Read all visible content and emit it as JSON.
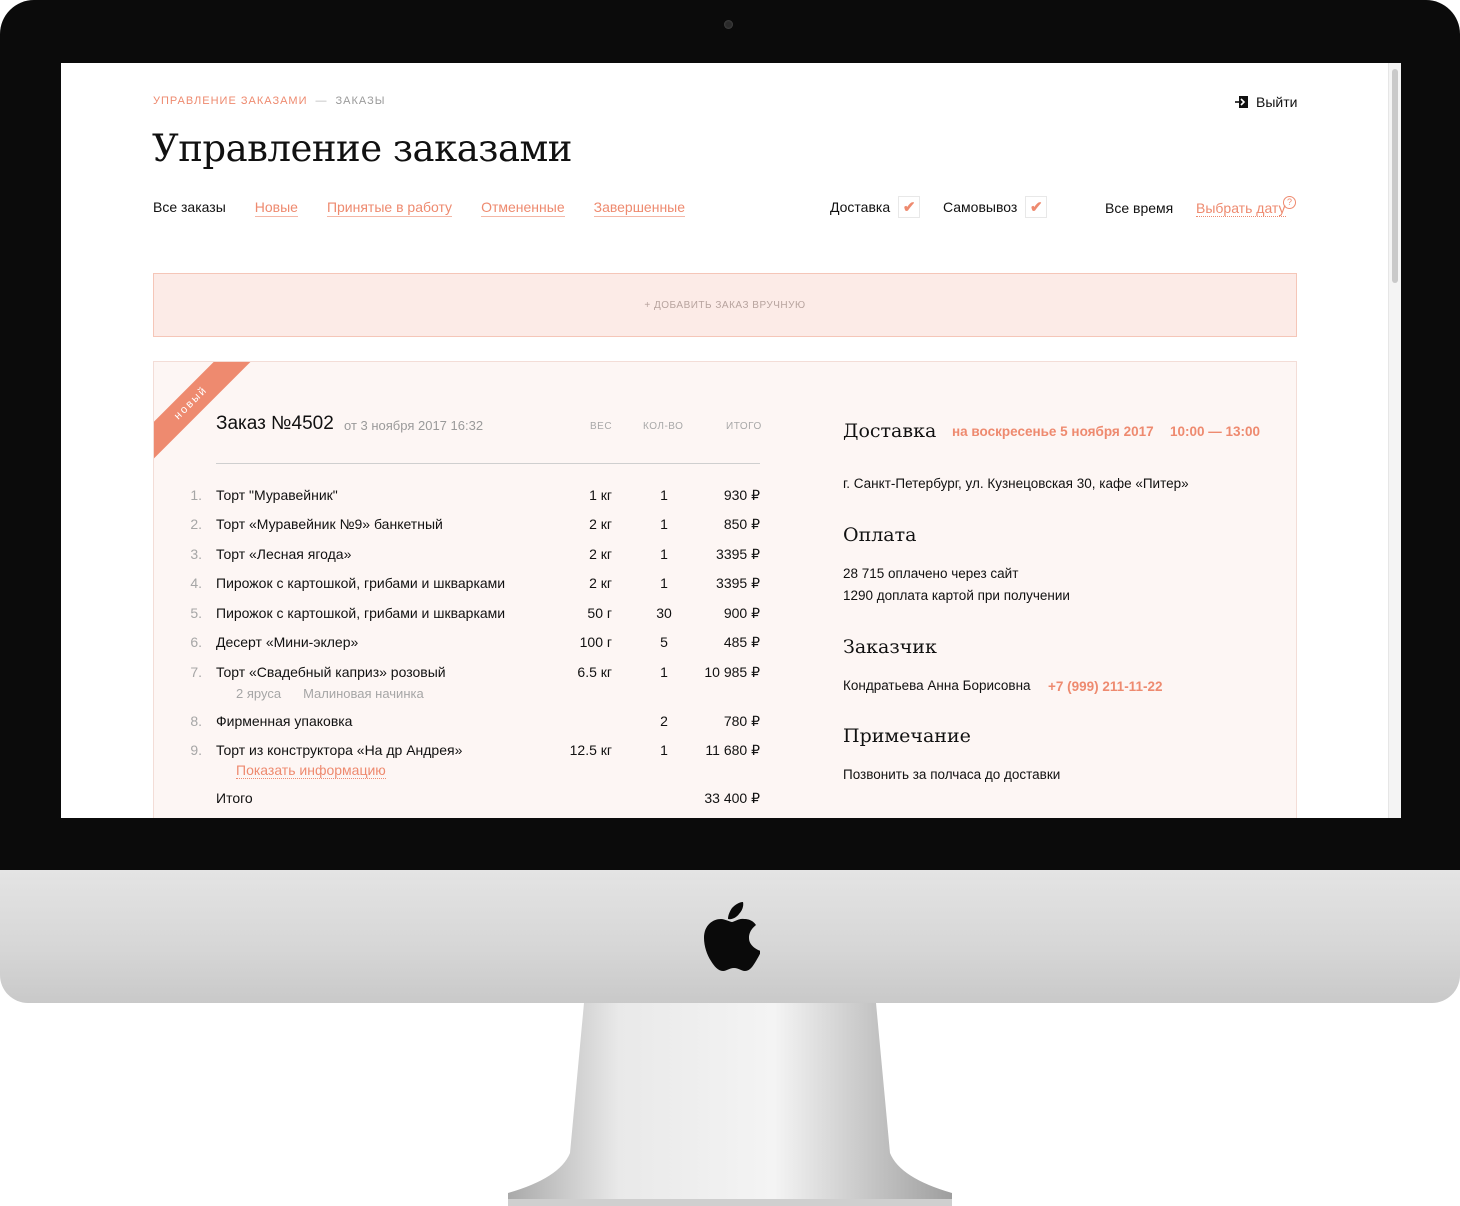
{
  "colors": {
    "accent": "#ee8a6f",
    "accent_bg": "#fcebe7",
    "card_bg": "#fdf6f4"
  },
  "breadcrumb": {
    "root": "Управление заказами",
    "separator": "—",
    "current": "Заказы"
  },
  "header": {
    "logout_label": "Выйти",
    "logout_icon": "logout-icon",
    "title": "Управление заказами"
  },
  "filters": {
    "tabs": [
      {
        "label": "Все заказы"
      },
      {
        "label": "Новые"
      },
      {
        "label": "Принятые в работу"
      },
      {
        "label": "Отмененные"
      },
      {
        "label": "Завершенные"
      }
    ],
    "delivery": {
      "label": "Доставка",
      "checked": true
    },
    "pickup": {
      "label": "Самовывоз",
      "checked": true
    },
    "time_all": "Все время",
    "pick_date": "Выбрать дату",
    "help": "?"
  },
  "add_order": "+ Добавить заказ вручную",
  "order": {
    "badge": "новый",
    "title": "Заказ №4502",
    "date": "от 3 ноября 2017 16:32",
    "columns": {
      "weight": "вес",
      "qty": "кол-во",
      "total": "итого"
    },
    "items": [
      {
        "num": "1.",
        "name": "Торт \"Муравейник\"",
        "weight": "1 кг",
        "qty": "1",
        "total": "930 ₽"
      },
      {
        "num": "2.",
        "name": "Торт «Муравейник №9» банкетный",
        "weight": "2 кг",
        "qty": "1",
        "total": "850 ₽"
      },
      {
        "num": "3.",
        "name": "Торт «Лесная ягода»",
        "weight": "2 кг",
        "qty": "1",
        "total": "3395 ₽"
      },
      {
        "num": "4.",
        "name": "Пирожок с картошкой, грибами и шкварками",
        "weight": "2 кг",
        "qty": "1",
        "total": "3395 ₽"
      },
      {
        "num": "5.",
        "name": "Пирожок с картошкой, грибами и шкварками",
        "weight": "50 г",
        "qty": "30",
        "total": "900 ₽"
      },
      {
        "num": "6.",
        "name": "Десерт «Мини-эклер»",
        "weight": "100 г",
        "qty": "5",
        "total": "485 ₽"
      },
      {
        "num": "7.",
        "name": "Торт «Свадебный каприз» розовый",
        "weight": "6.5 кг",
        "qty": "1",
        "total": "10 985 ₽",
        "details": [
          "2 яруса",
          "Малиновая начинка"
        ]
      },
      {
        "num": "8.",
        "name": "Фирменная упаковка",
        "weight": "",
        "qty": "2",
        "total": "780 ₽"
      },
      {
        "num": "9.",
        "name": "Торт из конструктора «На др Андрея»",
        "weight": "12.5 кг",
        "qty": "1",
        "total": "11 680 ₽",
        "link": "Показать информацию"
      }
    ],
    "summary_label": "Итого",
    "summary_total": "33 400 ₽",
    "delivery": {
      "heading": "Доставка",
      "date": "на воскресенье 5 ноября 2017",
      "time": "10:00 — 13:00",
      "address": "г. Санкт-Петербург, ул. Кузнецовская 30, кафе «Питер»"
    },
    "payment": {
      "heading": "Оплата",
      "line1": "28 715 оплачено через сайт",
      "line2": "1290 доплата картой при получении"
    },
    "customer": {
      "heading": "Заказчик",
      "name": "Кондратьева Анна Борисовна",
      "phone": "+7 (999) 211-11-22"
    },
    "note": {
      "heading": "Примечание",
      "text": "Позвонить за полчаса до доставки"
    }
  }
}
